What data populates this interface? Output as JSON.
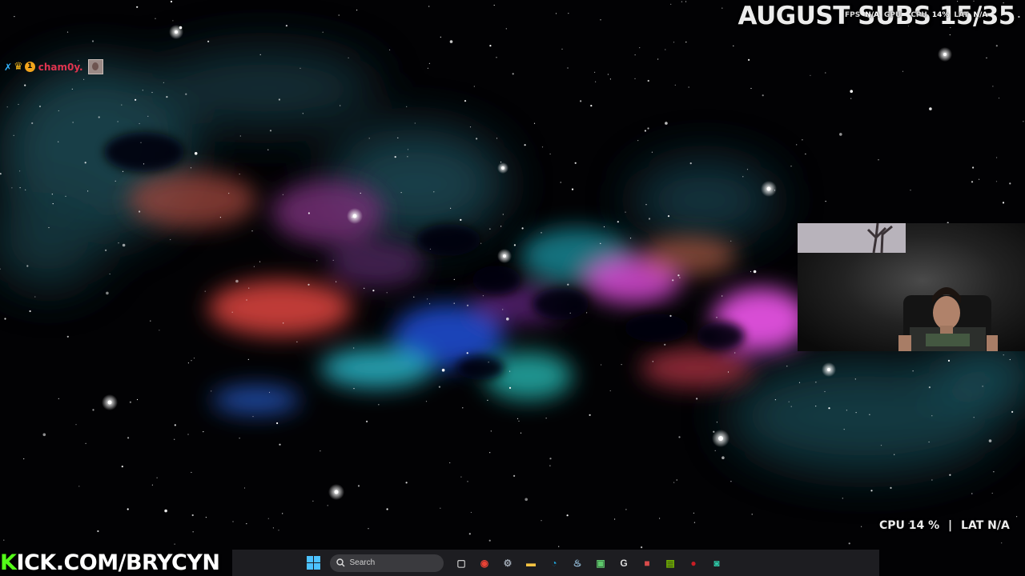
{
  "overlay": {
    "title": "AUGUST SUBS 15/35",
    "stats_top": {
      "fps_label": "FPS",
      "fps_value": "N/A",
      "gpu_label": "GPU",
      "gpu_value": "",
      "cpu_label": "CPU",
      "cpu_value": "14%",
      "lat_label": "LAT",
      "lat_value": "N/A"
    },
    "stats_bottom": {
      "cpu_label": "CPU",
      "cpu_value": "14 %",
      "sep": "|",
      "lat_label": "LAT",
      "lat_value": "N/A"
    },
    "brand_k": "K",
    "brand_rest": "ICK.COM/BRYCYN"
  },
  "chat": {
    "badge_count": "1",
    "username": "cham0y."
  },
  "webcam": {
    "label": ""
  },
  "taskbar": {
    "search_placeholder": "Search",
    "apps": [
      {
        "name": "task-view-icon",
        "color": "#c8c8c8",
        "glyph": "▢"
      },
      {
        "name": "chrome-icon",
        "color": "#e94235",
        "glyph": "◉"
      },
      {
        "name": "settings-icon",
        "color": "#9fa8b3",
        "glyph": "⚙"
      },
      {
        "name": "file-explorer-icon",
        "color": "#f6c342",
        "glyph": "▬"
      },
      {
        "name": "edge-icon",
        "color": "#1fa3d8",
        "glyph": "◔"
      },
      {
        "name": "steam-icon",
        "color": "#9bc6e3",
        "glyph": "♨"
      },
      {
        "name": "xbox-app-icon",
        "color": "#5ec86b",
        "glyph": "▣"
      },
      {
        "name": "google-icon",
        "color": "#dcdcdc",
        "glyph": "G"
      },
      {
        "name": "game-app-icon",
        "color": "#d94b4b",
        "glyph": "■"
      },
      {
        "name": "nvidia-icon",
        "color": "#76b900",
        "glyph": "▤"
      },
      {
        "name": "red-app-icon",
        "color": "#c81d25",
        "glyph": "●"
      },
      {
        "name": "discord-app-icon",
        "color": "#2ec7a6",
        "glyph": "◙"
      }
    ]
  },
  "colors": {
    "accent_green": "#53fc18",
    "username": "#e0344f",
    "windows_blue": "#4cc2ff"
  }
}
